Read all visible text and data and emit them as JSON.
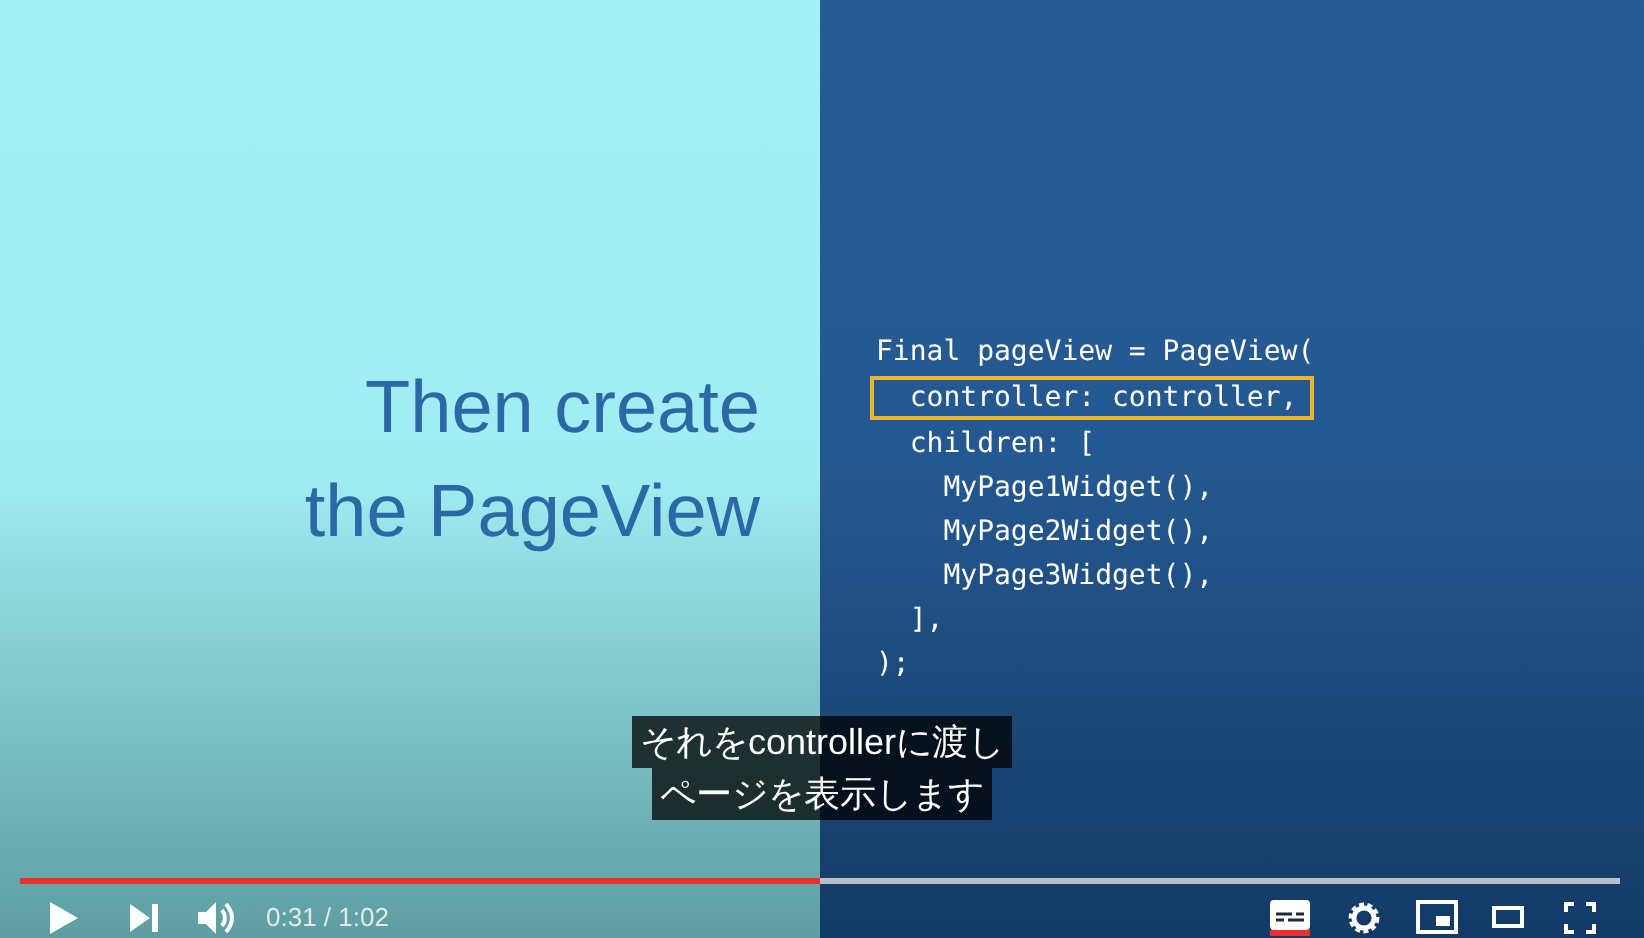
{
  "slide": {
    "title_lines": [
      "Then create",
      "the PageView"
    ],
    "code_lines": [
      {
        "text": "Final pageView = PageView(",
        "highlighted": false
      },
      {
        "text": "  controller: controller,",
        "highlighted": true
      },
      {
        "text": "  children: [",
        "highlighted": false
      },
      {
        "text": "    MyPage1Widget(),",
        "highlighted": false
      },
      {
        "text": "    MyPage2Widget(),",
        "highlighted": false
      },
      {
        "text": "    MyPage3Widget(),",
        "highlighted": false
      },
      {
        "text": "  ],",
        "highlighted": false
      },
      {
        "text": ");",
        "highlighted": false
      }
    ]
  },
  "subtitles": [
    "それをcontrollerに渡し",
    "ページを表示します"
  ],
  "player": {
    "progress": {
      "level": 0.5
    },
    "time": "0:31 / 1:02",
    "captions_on": true
  }
}
